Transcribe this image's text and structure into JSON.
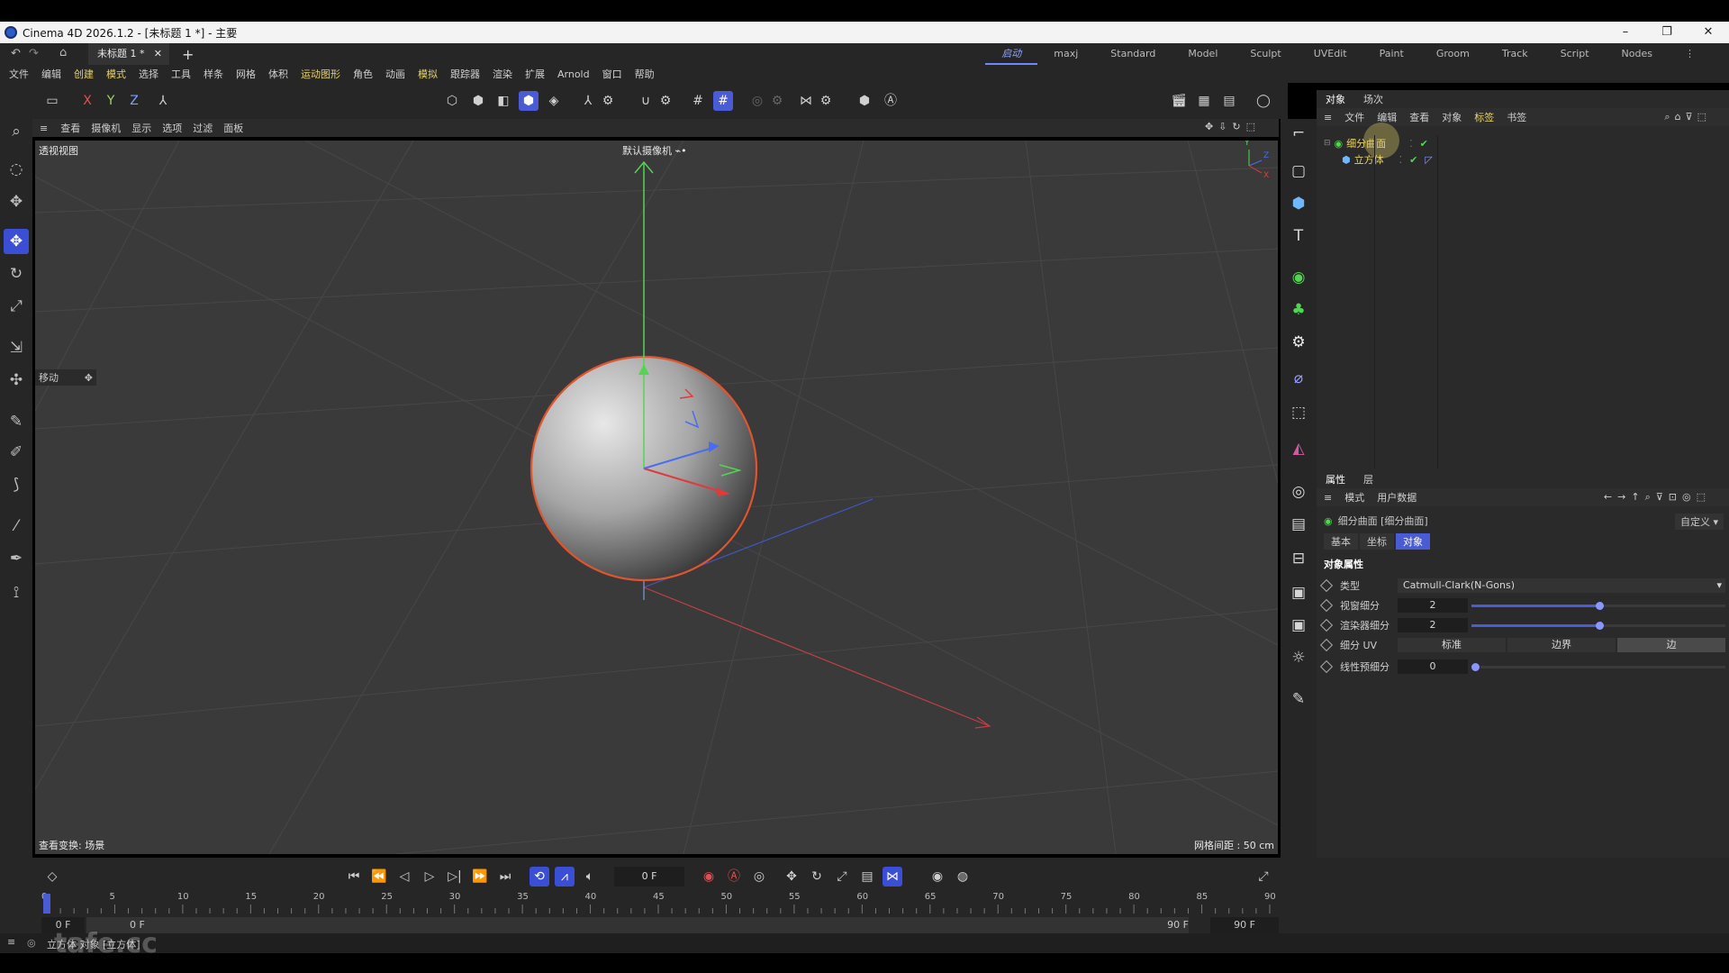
{
  "window": {
    "title": "Cinema 4D 2026.1.2 - [未标题 1 *] - 主要",
    "min": "–",
    "max": "❐",
    "close": "✕"
  },
  "tabs": {
    "doc_name": "未标题 1 *",
    "close": "✕",
    "add": "+"
  },
  "layouts": [
    "启动",
    "maxj",
    "Standard",
    "Model",
    "Sculpt",
    "UVEdit",
    "Paint",
    "Groom",
    "Track",
    "Script",
    "Nodes"
  ],
  "menu": [
    "文件",
    "编辑",
    "创建",
    "模式",
    "选择",
    "工具",
    "样条",
    "网格",
    "体积",
    "运动图形",
    "角色",
    "动画",
    "模拟",
    "跟踪器",
    "渲染",
    "扩展",
    "Arnold",
    "窗口",
    "帮助"
  ],
  "axes_toolbar": {
    "x": "X",
    "y": "Y",
    "z": "Z"
  },
  "viewport_menu": [
    "查看",
    "摄像机",
    "显示",
    "选项",
    "过滤",
    "面板"
  ],
  "viewport": {
    "name": "透视视图",
    "camera": "默认摄像机 ⌁•",
    "tool_label": "移动",
    "transform_label": "查看变换: 场景",
    "grid_spacing": "网格间距 : 50 cm",
    "gizmo_y": "Y",
    "gizmo_z": "Z",
    "gizmo_x": "X"
  },
  "object_manager": {
    "tabs": [
      "对象",
      "场次"
    ],
    "menu": [
      "文件",
      "编辑",
      "查看",
      "对象",
      "标签",
      "书签"
    ],
    "objects": [
      {
        "name": "细分曲面",
        "color": "#e6d36a"
      },
      {
        "name": "立方体",
        "color": "#e6d36a"
      }
    ]
  },
  "attribute_manager": {
    "tabs": [
      "属性",
      "层"
    ],
    "menu": [
      "模式",
      "用户数据"
    ],
    "object_title": "细分曲面 [细分曲面]",
    "preset": "自定义",
    "subtabs": [
      "基本",
      "坐标",
      "对象"
    ],
    "section": "对象属性",
    "rows": [
      {
        "label": "类型",
        "value": "Catmull-Clark(N-Gons)"
      },
      {
        "label": "视窗细分",
        "value": "2"
      },
      {
        "label": "渲染器细分",
        "value": "2"
      },
      {
        "label": "细分 UV",
        "options": [
          "标准",
          "边界",
          "边"
        ]
      },
      {
        "label": "线性预细分",
        "value": "0"
      }
    ]
  },
  "timeline": {
    "current_frame": "0 F",
    "ruler_ticks": [
      "0",
      "5",
      "10",
      "15",
      "20",
      "25",
      "30",
      "35",
      "40",
      "45",
      "50",
      "55",
      "60",
      "65",
      "70",
      "75",
      "80",
      "85",
      "90"
    ],
    "range_start": "0 F",
    "range_start2": "0 F",
    "range_end": "90 F",
    "range_end2": "90 F"
  },
  "status": {
    "text": "立方体 对象 [立方体]",
    "watermark": "tafe.cc"
  },
  "colors": {
    "accent": "#4a5bd6",
    "highlight": "#e6d36a",
    "selection": "#e8542d"
  }
}
